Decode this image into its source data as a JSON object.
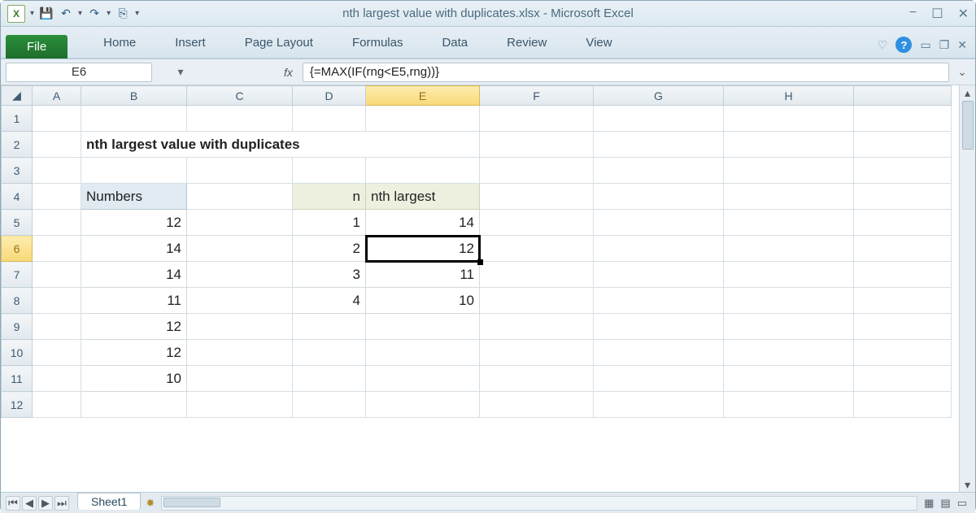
{
  "app": {
    "title": "nth largest value with duplicates.xlsx  -  Microsoft Excel",
    "file_tab": "File",
    "tabs": [
      "Home",
      "Insert",
      "Page Layout",
      "Formulas",
      "Data",
      "Review",
      "View"
    ]
  },
  "qat": {
    "save": "💾",
    "undo": "↶",
    "redo": "↷",
    "touch": "☰"
  },
  "formula_bar": {
    "cell_ref": "E6",
    "fx": "fx",
    "formula": "{=MAX(IF(rng<E5,rng))}"
  },
  "columns": [
    "A",
    "B",
    "C",
    "D",
    "E",
    "F",
    "G",
    "H"
  ],
  "rows": [
    "1",
    "2",
    "3",
    "4",
    "5",
    "6",
    "7",
    "8",
    "9",
    "10",
    "11",
    "12"
  ],
  "content": {
    "title_cell": "nth largest value with duplicates",
    "numbers_header": "Numbers",
    "numbers": [
      "12",
      "14",
      "14",
      "11",
      "12",
      "12",
      "10"
    ],
    "n_header": "n",
    "nth_header": "nth largest",
    "n_vals": [
      "1",
      "2",
      "3",
      "4"
    ],
    "nth_vals": [
      "14",
      "12",
      "11",
      "10"
    ]
  },
  "selection": {
    "col": "E",
    "row": "6"
  },
  "sheet": {
    "active": "Sheet1"
  }
}
